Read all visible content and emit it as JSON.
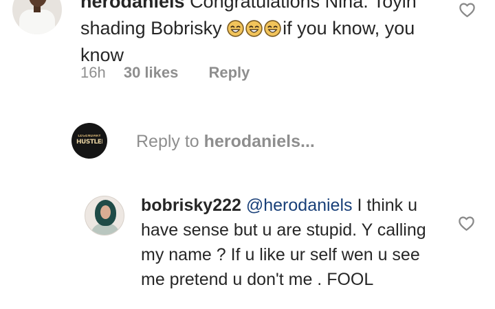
{
  "comment_1": {
    "username": "herodaniels",
    "text_start": "Congratulations Nina. Toyin shading Bobrisky ",
    "text_end": "if you know, you know",
    "emoji": [
      "laughing-face-emoji",
      "laughing-face-emoji",
      "laughing-face-emoji"
    ],
    "time": "16h",
    "likes": "30 likes",
    "reply_label": "Reply",
    "like_icon": "heart-outline-icon"
  },
  "reply_box": {
    "prefix": "Reply to ",
    "mention": "herodaniels...",
    "avatar_text_top": "LEGENDARY",
    "avatar_text_main": "HUSTLER"
  },
  "comment_2": {
    "username": "bobrisky222",
    "mention": "@herodaniels",
    "text": " I think u have sense but u are stupid. Y calling my name ? If u like ur self wen u see me pretend u don't me . FOOL",
    "like_icon": "heart-outline-icon"
  },
  "colors": {
    "text": "#262626",
    "muted": "#8e8e8e",
    "mention": "#183f78",
    "icon": "#8a8a8a"
  }
}
